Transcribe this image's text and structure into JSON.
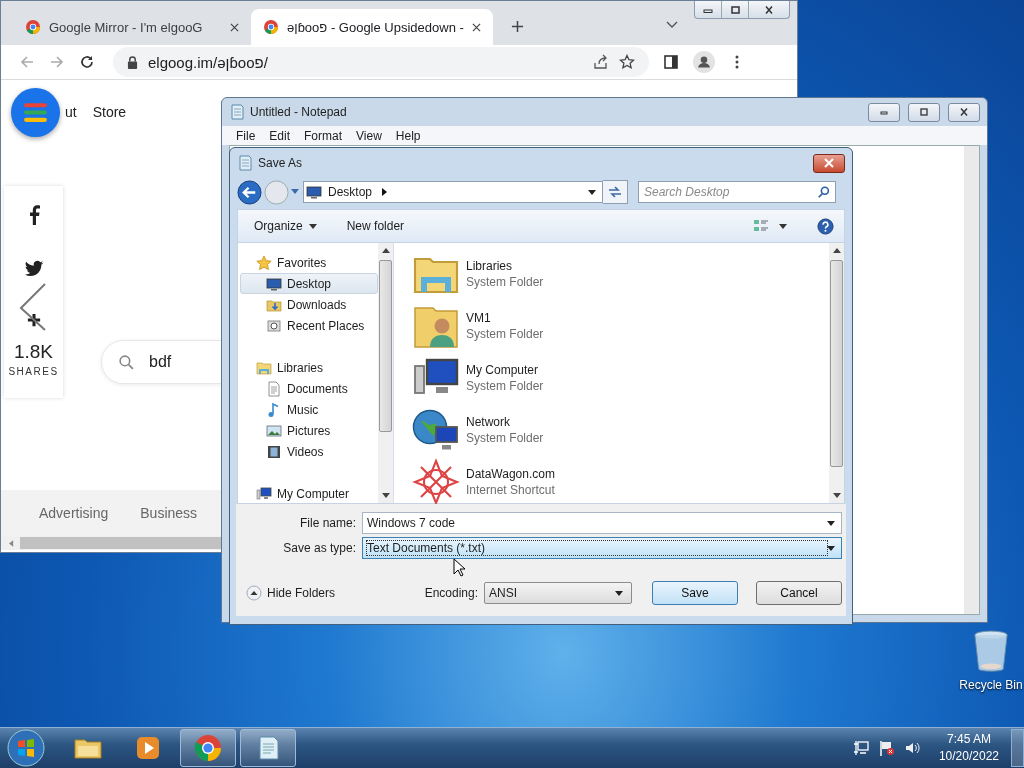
{
  "browser": {
    "tabs": [
      {
        "title": "Google Mirror - I'm elgooG",
        "selected": false
      },
      {
        "title": "ǝןɓooפ - Google Upsidedown -",
        "selected": true
      }
    ],
    "address": "elgoog.im/ǝןɓooפ/",
    "page": {
      "nav": [
        "ut",
        "Store"
      ],
      "share_count": "1.8K",
      "share_label": "SHARES",
      "search_value": "bdf",
      "footer": [
        "Advertising",
        "Business"
      ]
    }
  },
  "notepad": {
    "title": "Untitled - Notepad",
    "menu": [
      "File",
      "Edit",
      "Format",
      "View",
      "Help"
    ]
  },
  "save_as": {
    "title": "Save As",
    "location": "Desktop",
    "search_placeholder": "Search Desktop",
    "toolbar": [
      "Organize",
      "New folder"
    ],
    "nav": [
      {
        "label": "Favorites",
        "kind": "star",
        "selected": false,
        "children": [
          {
            "label": "Desktop",
            "kind": "desktop",
            "selected": true
          },
          {
            "label": "Downloads",
            "kind": "downloads",
            "selected": false
          },
          {
            "label": "Recent Places",
            "kind": "recent",
            "selected": false
          }
        ]
      },
      {
        "label": "Libraries",
        "kind": "libraries",
        "selected": false,
        "children": [
          {
            "label": "Documents",
            "kind": "documents",
            "selected": false
          },
          {
            "label": "Music",
            "kind": "music",
            "selected": false
          },
          {
            "label": "Pictures",
            "kind": "pictures",
            "selected": false
          },
          {
            "label": "Videos",
            "kind": "videos",
            "selected": false
          }
        ]
      },
      {
        "label": "My Computer",
        "kind": "computer",
        "selected": false
      }
    ],
    "items": [
      {
        "name": "Libraries",
        "type": "System Folder",
        "kind": "libraries"
      },
      {
        "name": "VM1",
        "type": "System Folder",
        "kind": "user"
      },
      {
        "name": "My Computer",
        "type": "System Folder",
        "kind": "computer"
      },
      {
        "name": "Network",
        "type": "System Folder",
        "kind": "network"
      },
      {
        "name": "DataWagon.com",
        "type": "Internet Shortcut",
        "kind": "shortcut"
      }
    ],
    "file_name_label": "File name:",
    "file_name": "Windows 7 code",
    "type_label": "Save as type:",
    "type": "Text Documents (*.txt)",
    "hide_folders": "Hide Folders",
    "encoding_label": "Encoding:",
    "encoding": "ANSI",
    "buttons": [
      "Save",
      "Cancel"
    ]
  },
  "desktop": {
    "icons": [
      {
        "label": "Recycle Bin"
      }
    ]
  },
  "taskbar": {
    "apps": [
      {
        "kind": "explorer",
        "running": false
      },
      {
        "kind": "media",
        "running": false
      },
      {
        "kind": "chrome",
        "running": true
      },
      {
        "kind": "notepad",
        "running": true
      }
    ],
    "time": "7:45 AM",
    "date": "10/20/2022"
  }
}
